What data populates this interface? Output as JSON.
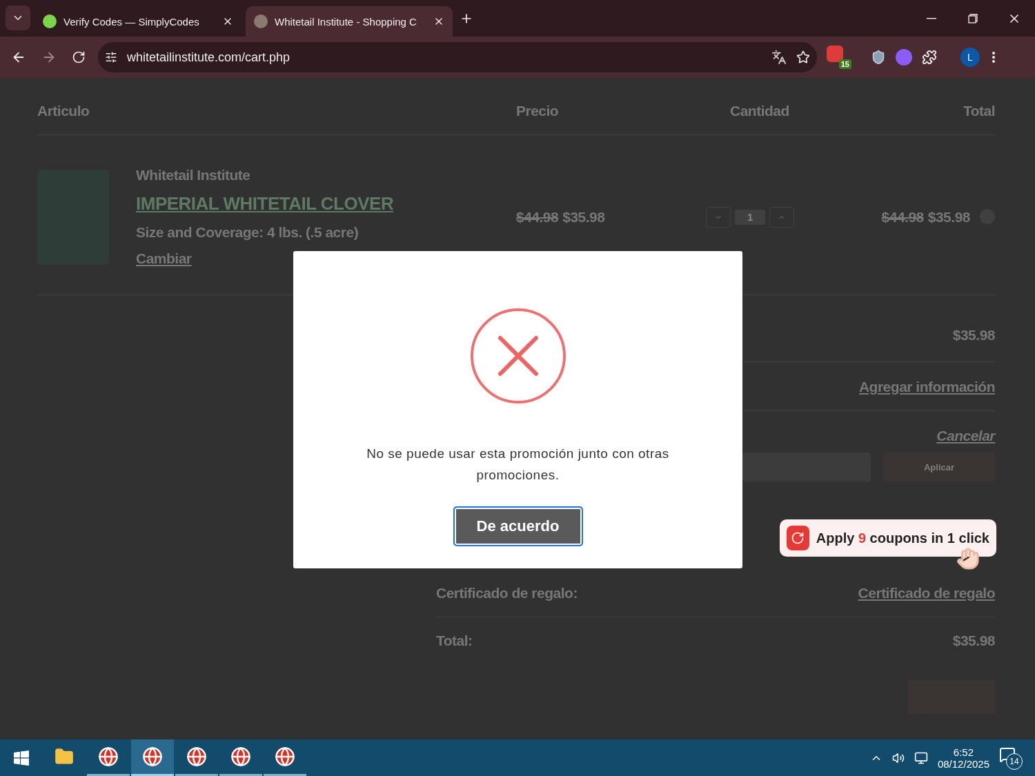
{
  "browser": {
    "tabs": [
      {
        "title": "Verify Codes — SimplyCodes",
        "selected": false
      },
      {
        "title": "Whitetail Institute - Shopping C",
        "selected": true
      }
    ],
    "address": "whitetailinstitute.com/cart.php",
    "extension_badge": "15",
    "profile_initial": "L"
  },
  "cart": {
    "columns": [
      "Articulo",
      "Precio",
      "Cantidad",
      "Total"
    ],
    "item": {
      "brand": "Whitetail Institute",
      "name": "IMPERIAL WHITETAIL CLOVER",
      "option": "Size and Coverage: 4 lbs. (.5 acre)",
      "change_link": "Cambiar",
      "price_old": "$44.98",
      "price": "$35.98",
      "quantity": "1",
      "total_old": "$44.98",
      "total": "$35.98"
    }
  },
  "summary": {
    "subtotal": "$35.98",
    "shipping_link": "Agregar información",
    "coupon_cancel": "Cancelar",
    "coupon_button": "Aplicar",
    "gift_label": "Certificado de regalo:",
    "gift_link": "Certificado de regalo",
    "total_label": "Total:",
    "total": "$35.98"
  },
  "dialog": {
    "message": "No se puede usar esta promoción junto con otras promociones.",
    "button": "De acuerdo"
  },
  "coupon_popup": {
    "before": "Apply",
    "count": "9",
    "after": "coupons in 1 click"
  },
  "taskbar": {
    "apps": [
      {
        "kind": "folder",
        "selected": false
      },
      {
        "kind": "browser",
        "selected": false
      },
      {
        "kind": "browser",
        "selected": true
      },
      {
        "kind": "browser",
        "selected": false
      },
      {
        "kind": "browser",
        "selected": false
      },
      {
        "kind": "browser",
        "selected": false
      }
    ],
    "time": "6:52",
    "date": "08/12/2025",
    "notifications": "14"
  }
}
